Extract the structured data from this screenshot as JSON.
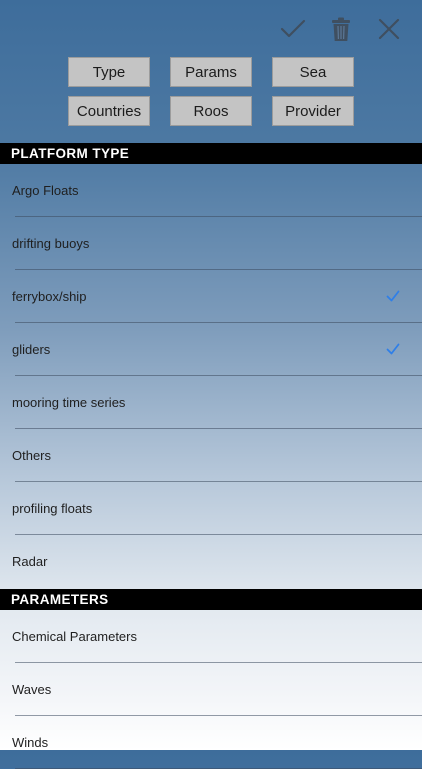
{
  "toolbar": {
    "confirm_icon": "checkmark-icon",
    "delete_icon": "trash-icon",
    "close_icon": "close-icon"
  },
  "filters": [
    {
      "label": "Type"
    },
    {
      "label": "Params"
    },
    {
      "label": "Sea"
    },
    {
      "label": "Countries"
    },
    {
      "label": "Roos"
    },
    {
      "label": "Provider"
    }
  ],
  "platform_section": {
    "title": "PLATFORM TYPE",
    "items": [
      {
        "label": "Argo Floats",
        "checked": false
      },
      {
        "label": "drifting buoys",
        "checked": false
      },
      {
        "label": "ferrybox/ship",
        "checked": true
      },
      {
        "label": "gliders",
        "checked": true
      },
      {
        "label": "mooring time series",
        "checked": false
      },
      {
        "label": "Others",
        "checked": false
      },
      {
        "label": "profiling floats",
        "checked": false
      },
      {
        "label": "Radar",
        "checked": false
      }
    ]
  },
  "parameters_section": {
    "title": "PARAMETERS",
    "items": [
      {
        "label": "Chemical Parameters",
        "checked": false
      },
      {
        "label": "Waves",
        "checked": false
      },
      {
        "label": "Winds",
        "checked": false
      }
    ]
  },
  "colors": {
    "checkmark": "#2f7fe8",
    "toolbar_icon": "#3f4f60"
  }
}
